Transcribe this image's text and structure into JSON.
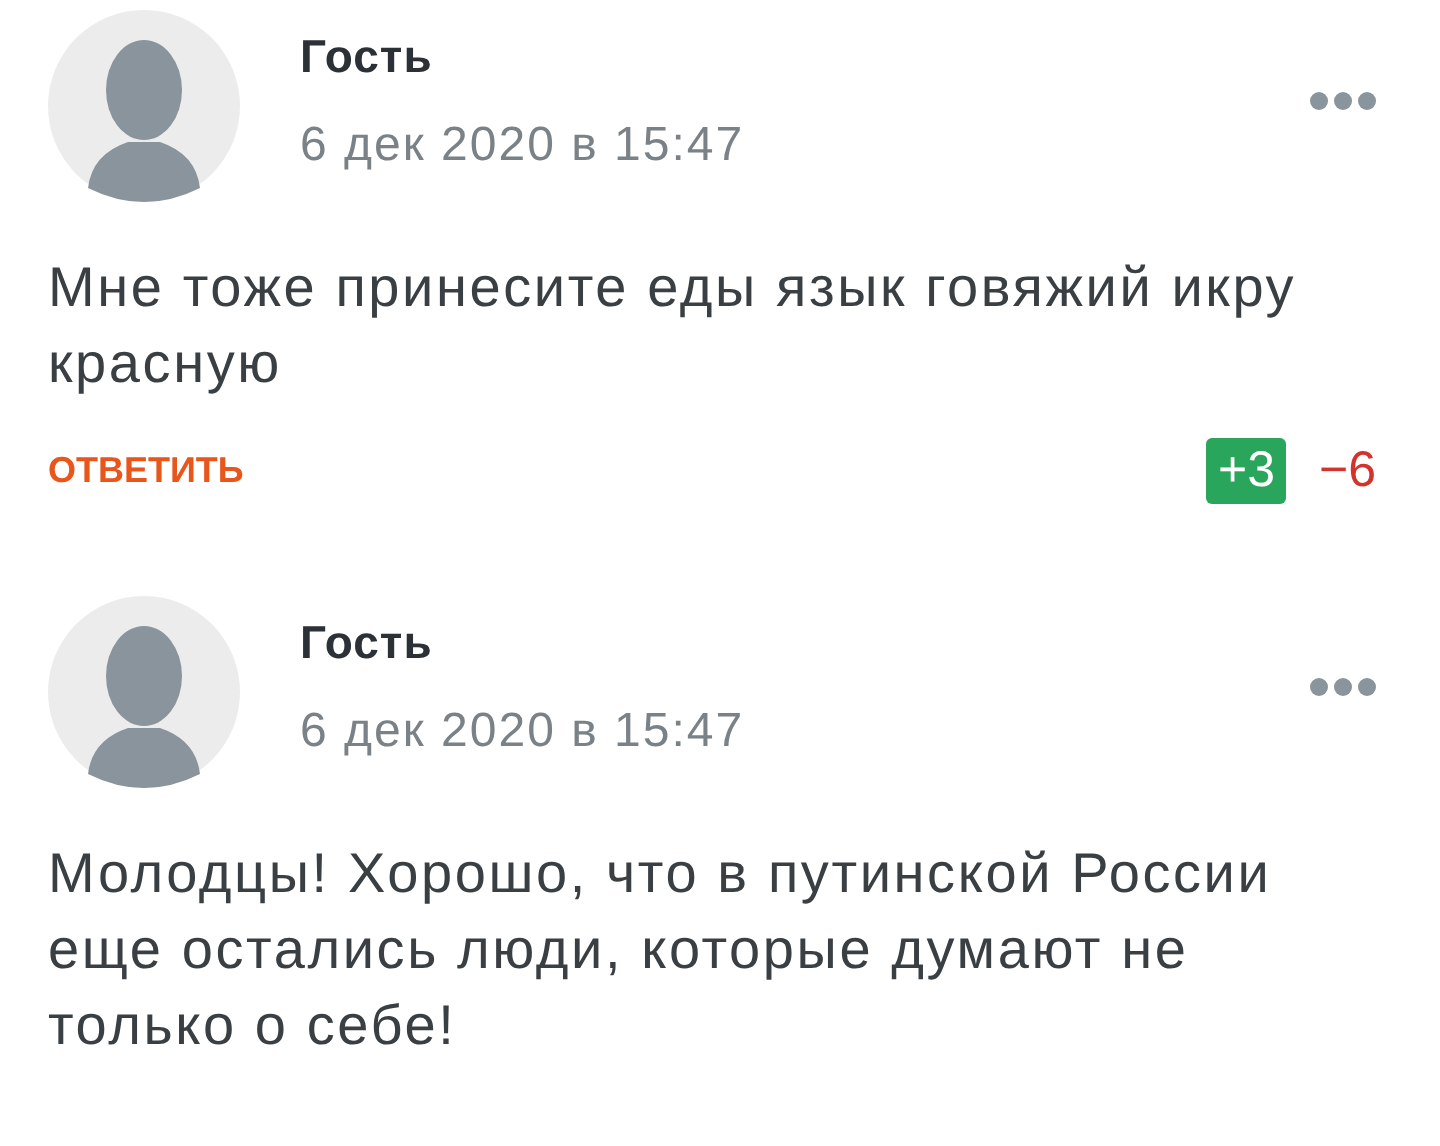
{
  "comments": [
    {
      "author": "Гость",
      "date": "6 дек 2020 в 15:47",
      "text": "Мне тоже принесите еды язык говяжий икру красную",
      "reply": "ОТВЕТИТЬ",
      "likes": "+3",
      "dislikes": "−6",
      "upvoted": true
    },
    {
      "author": "Гость",
      "date": "6 дек 2020 в 15:47",
      "text": "Молодцы! Хорошо, что в путинской России еще остались люди, которые думают не только о себе!"
    }
  ]
}
